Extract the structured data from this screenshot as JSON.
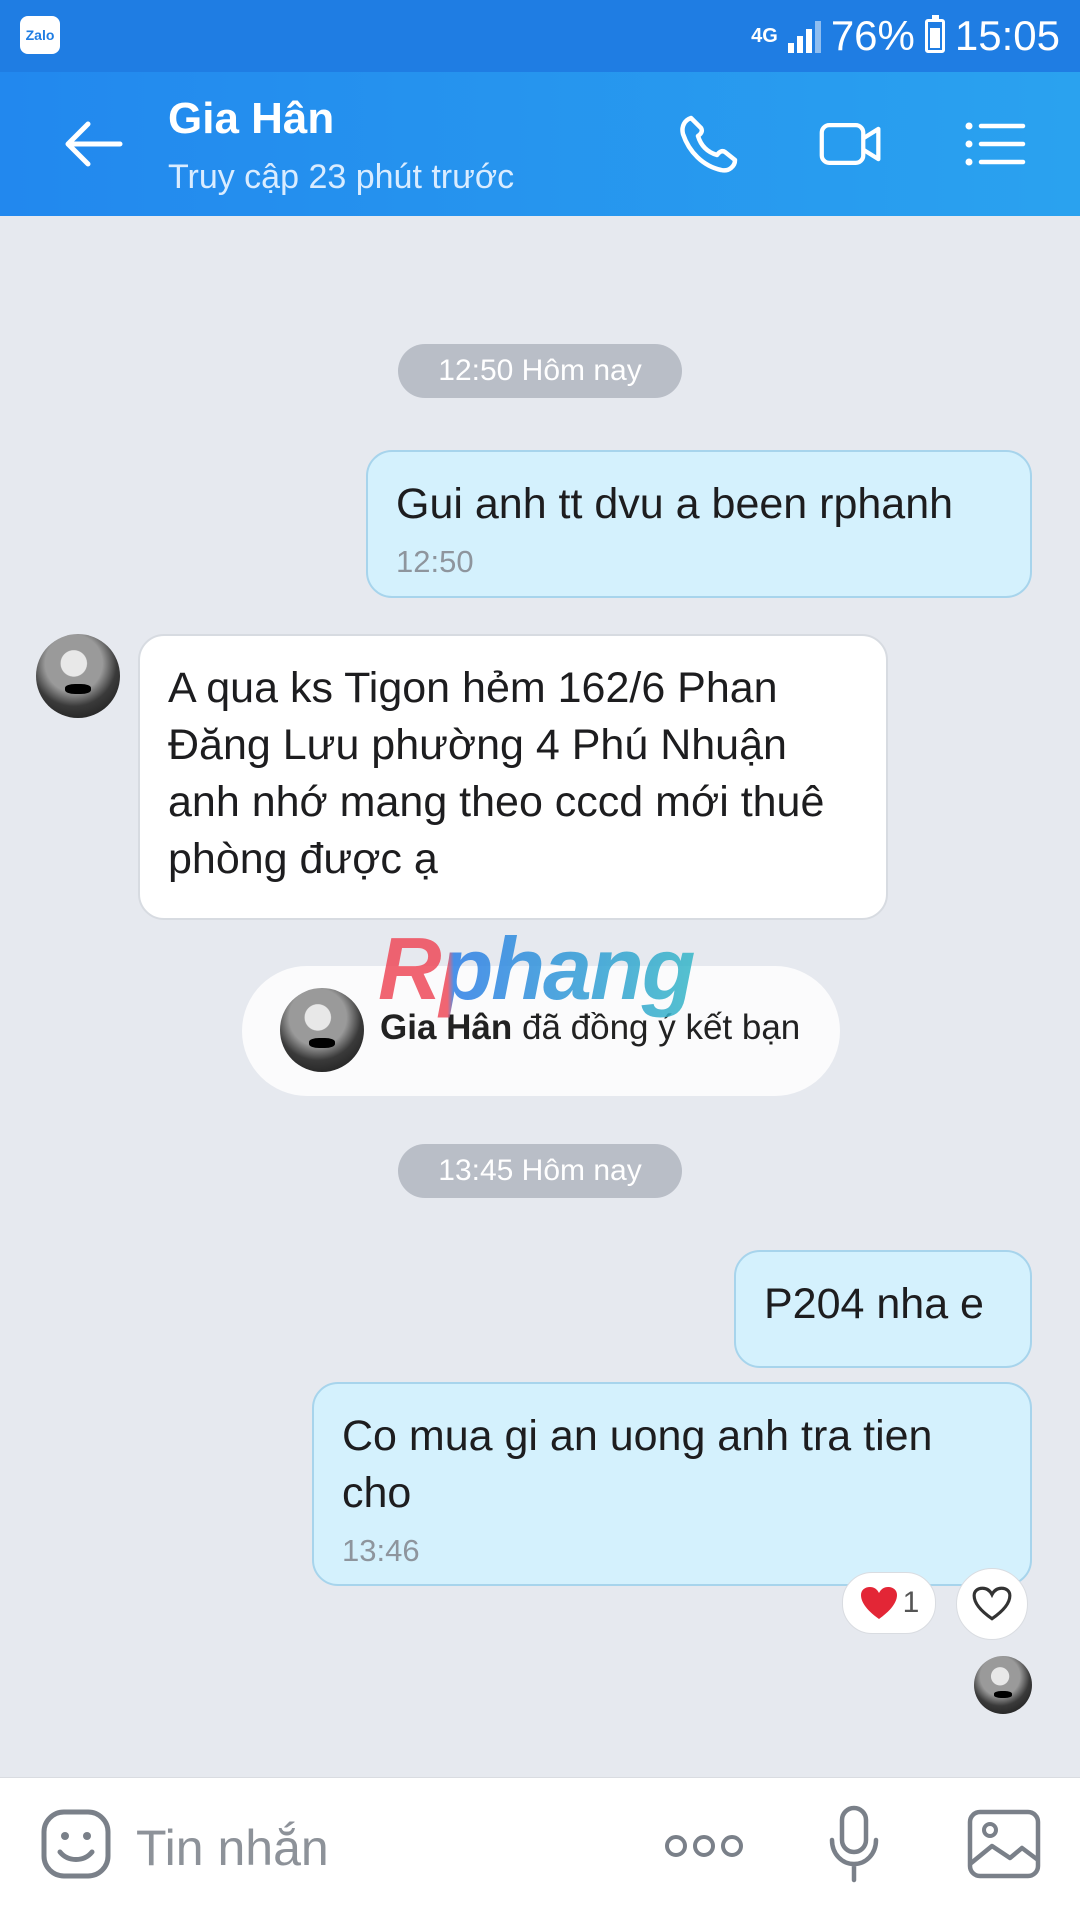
{
  "status_bar": {
    "app": "Zalo",
    "network": "4G",
    "battery": "76%",
    "time": "15:05"
  },
  "header": {
    "contact_name": "Gia Hân",
    "last_seen": "Truy cập 23 phút trước"
  },
  "chat": {
    "time_chip_1": "12:50 Hôm nay",
    "msg1": {
      "text": "Gui anh tt dvu a been rphanh",
      "time": "12:50"
    },
    "msg2": {
      "text": "A qua ks Tigon hẻm 162/6 Phan Đăng Lưu phường 4 Phú Nhuận anh nhớ mang theo cccd mới thuê phòng được ạ"
    },
    "system": {
      "name": "Gia Hân",
      "text": " đã đồng ý kết bạn"
    },
    "watermark": "Rphang",
    "time_chip_2": "13:45 Hôm nay",
    "msg3": {
      "text": "P204 nha e"
    },
    "msg4": {
      "text": "Co mua gi an uong anh tra tien cho",
      "time": "13:46"
    },
    "reaction": {
      "emoji": "heart-icon",
      "count": "1"
    }
  },
  "input": {
    "placeholder": "Tin nhắn"
  },
  "colors": {
    "header": "#2288ee",
    "outgoing_bubble": "#d4f1fd",
    "background": "#e6e9ef"
  }
}
